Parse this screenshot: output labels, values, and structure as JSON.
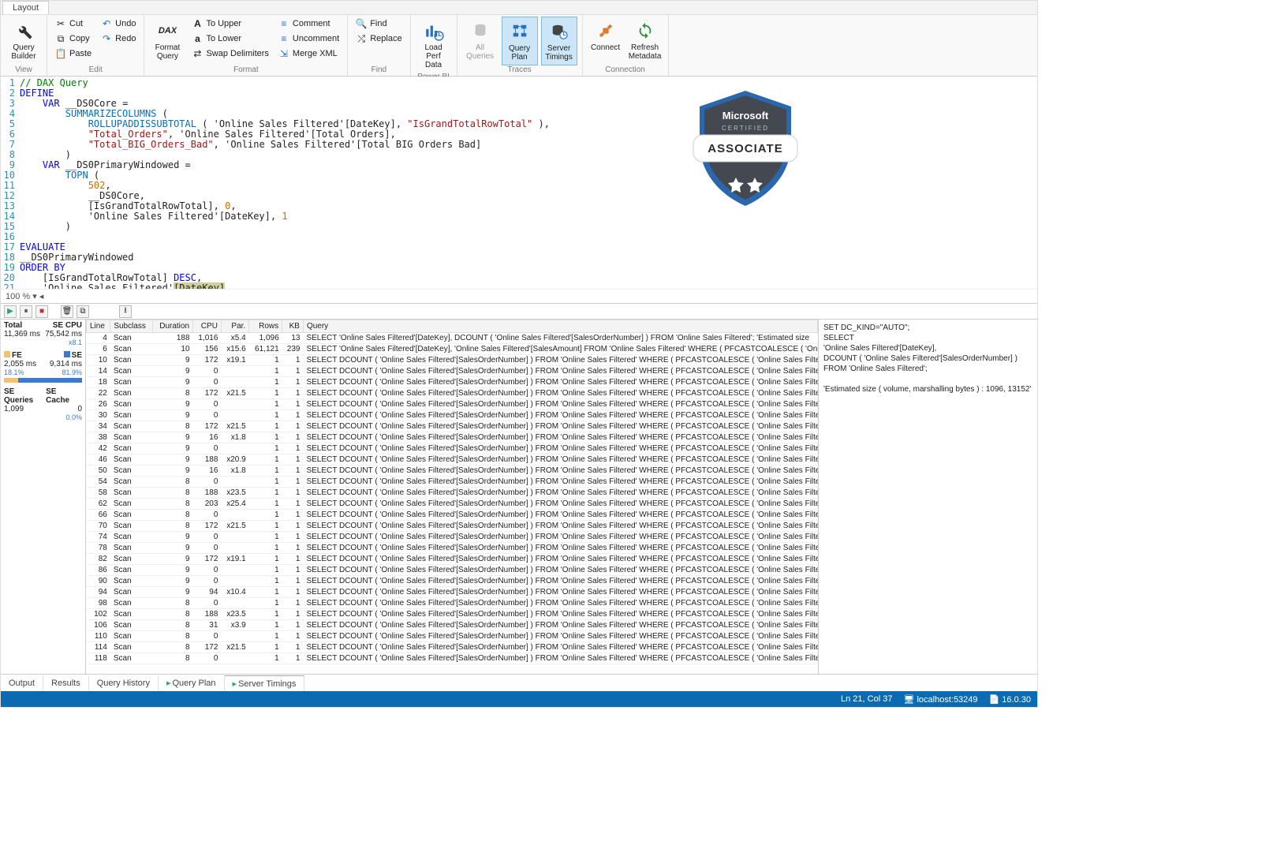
{
  "tabs": {
    "layout": "Layout"
  },
  "ribbon": {
    "view": {
      "label": "View",
      "query_builder": "Query\nBuilder"
    },
    "edit": {
      "label": "Edit",
      "cut": "Cut",
      "copy": "Copy",
      "paste": "Paste",
      "undo": "Undo",
      "redo": "Redo"
    },
    "format": {
      "label": "Format",
      "format_query": "Format\nQuery",
      "to_upper": "To Upper",
      "to_lower": "To Lower",
      "swap": "Swap Delimiters",
      "comment": "Comment",
      "uncomment": "Uncomment",
      "merge_xml": "Merge XML"
    },
    "find": {
      "label": "Find",
      "find": "Find",
      "replace": "Replace"
    },
    "powerbi": {
      "label": "Power BI",
      "load_perf": "Load Perf\nData"
    },
    "traces": {
      "label": "Traces",
      "all_queries": "All\nQueries",
      "query_plan": "Query\nPlan",
      "server_timings": "Server\nTimings"
    },
    "connection": {
      "label": "Connection",
      "connect": "Connect",
      "refresh": "Refresh\nMetadata"
    }
  },
  "zoom": "100 % ▾  ◂",
  "code": {
    "lines": [
      {
        "n": 1,
        "seg": [
          [
            "// DAX Query",
            "tok-comment"
          ]
        ]
      },
      {
        "n": 2,
        "seg": [
          [
            "DEFINE",
            "tok-kw"
          ]
        ]
      },
      {
        "n": 3,
        "seg": [
          [
            "    ",
            ""
          ],
          [
            "VAR",
            "tok-kw"
          ],
          [
            " __DS0Core =",
            ""
          ]
        ]
      },
      {
        "n": 4,
        "seg": [
          [
            "        ",
            ""
          ],
          [
            "SUMMARIZECOLUMNS",
            "tok-func"
          ],
          [
            " (",
            ""
          ]
        ]
      },
      {
        "n": 5,
        "seg": [
          [
            "            ",
            ""
          ],
          [
            "ROLLUPADDISSUBTOTAL",
            "tok-func"
          ],
          [
            " ( 'Online Sales Filtered'[DateKey], ",
            ""
          ],
          [
            "\"IsGrandTotalRowTotal\"",
            "tok-str"
          ],
          [
            " ),",
            ""
          ]
        ]
      },
      {
        "n": 6,
        "seg": [
          [
            "            ",
            ""
          ],
          [
            "\"Total_Orders\"",
            "tok-str"
          ],
          [
            ", 'Online Sales Filtered'[Total Orders],",
            ""
          ]
        ]
      },
      {
        "n": 7,
        "seg": [
          [
            "            ",
            ""
          ],
          [
            "\"Total_BIG_Orders_Bad\"",
            "tok-str"
          ],
          [
            ", 'Online Sales Filtered'[Total BIG Orders Bad]",
            ""
          ]
        ]
      },
      {
        "n": 8,
        "seg": [
          [
            "        )",
            ""
          ]
        ]
      },
      {
        "n": 9,
        "seg": [
          [
            "    ",
            ""
          ],
          [
            "VAR",
            "tok-kw"
          ],
          [
            " __DS0PrimaryWindowed =",
            ""
          ]
        ]
      },
      {
        "n": 10,
        "seg": [
          [
            "        ",
            ""
          ],
          [
            "TOPN",
            "tok-func"
          ],
          [
            " (",
            ""
          ]
        ]
      },
      {
        "n": 11,
        "seg": [
          [
            "            ",
            ""
          ],
          [
            "502",
            "tok-num"
          ],
          [
            ",",
            ""
          ]
        ]
      },
      {
        "n": 12,
        "seg": [
          [
            "            __DS0Core,",
            ""
          ]
        ]
      },
      {
        "n": 13,
        "seg": [
          [
            "            [IsGrandTotalRowTotal], ",
            ""
          ],
          [
            "0",
            "tok-num"
          ],
          [
            ",",
            ""
          ]
        ]
      },
      {
        "n": 14,
        "seg": [
          [
            "            'Online Sales Filtered'[DateKey], ",
            ""
          ],
          [
            "1",
            "tok-num"
          ]
        ]
      },
      {
        "n": 15,
        "seg": [
          [
            "        )",
            ""
          ]
        ]
      },
      {
        "n": 16,
        "seg": [
          [
            "",
            ""
          ]
        ]
      },
      {
        "n": 17,
        "seg": [
          [
            "EVALUATE",
            "tok-kw"
          ]
        ]
      },
      {
        "n": 18,
        "seg": [
          [
            "__DS0PrimaryWindowed",
            ""
          ]
        ]
      },
      {
        "n": 19,
        "seg": [
          [
            "ORDER BY",
            "tok-kw"
          ]
        ]
      },
      {
        "n": 20,
        "seg": [
          [
            "    [IsGrandTotalRowTotal] ",
            ""
          ],
          [
            "DESC",
            "tok-kw"
          ],
          [
            ",",
            ""
          ]
        ]
      },
      {
        "n": 21,
        "seg": [
          [
            "    'Online Sales Filtered'",
            ""
          ],
          [
            "[DateKey]",
            "tok-hl"
          ]
        ]
      }
    ]
  },
  "stats": {
    "headers": [
      "Total",
      "SE CPU"
    ],
    "total": "11,369 ms",
    "se_cpu": "75,542 ms",
    "se_ratio": "x8.1",
    "fe_label": "FE",
    "se_label": "SE",
    "fe_ms": "2,055 ms",
    "se_ms": "9,314 ms",
    "fe_pct": "18.1%",
    "se_pct": "81.9%",
    "seq_label": "SE Queries",
    "sec_label": "SE Cache",
    "seq": "1,099",
    "sec": "0",
    "sec_pct": "0.0%"
  },
  "grid": {
    "cols": [
      "Line",
      "Subclass",
      "Duration",
      "CPU",
      "Par.",
      "Rows",
      "KB",
      "Query"
    ],
    "q1": "SELECT 'Online Sales Filtered'[DateKey], DCOUNT ( 'Online Sales Filtered'[SalesOrderNumber] ) FROM 'Online Sales Filtered';   'Estimated size",
    "q2": "SELECT 'Online Sales Filtered'[DateKey], 'Online Sales Filtered'[SalesAmount] FROM 'Online Sales Filtered' WHERE ( PFCASTCOALESCE ( 'Onlin",
    "qd": "SELECT DCOUNT ( 'Online Sales Filtered'[SalesOrderNumber] ) FROM 'Online Sales Filtered' WHERE ( PFCASTCOALESCE ( 'Online Sales Filtere",
    "rows": [
      {
        "l": 4,
        "sc": "Scan",
        "d": 188,
        "c": "1,016",
        "p": "x5.4",
        "r": "1,096",
        "k": 13,
        "qref": "q1"
      },
      {
        "l": 6,
        "sc": "Scan",
        "d": 10,
        "c": 156,
        "p": "x15.6",
        "r": "61,121",
        "k": 239,
        "qref": "q2"
      },
      {
        "l": 10,
        "sc": "Scan",
        "d": 9,
        "c": 172,
        "p": "x19.1",
        "r": 1,
        "k": 1,
        "qref": "qd"
      },
      {
        "l": 14,
        "sc": "Scan",
        "d": 9,
        "c": 0,
        "p": "",
        "r": 1,
        "k": 1,
        "qref": "qd"
      },
      {
        "l": 18,
        "sc": "Scan",
        "d": 9,
        "c": 0,
        "p": "",
        "r": 1,
        "k": 1,
        "qref": "qd"
      },
      {
        "l": 22,
        "sc": "Scan",
        "d": 8,
        "c": 172,
        "p": "x21.5",
        "r": 1,
        "k": 1,
        "qref": "qd"
      },
      {
        "l": 26,
        "sc": "Scan",
        "d": 9,
        "c": 0,
        "p": "",
        "r": 1,
        "k": 1,
        "qref": "qd"
      },
      {
        "l": 30,
        "sc": "Scan",
        "d": 9,
        "c": 0,
        "p": "",
        "r": 1,
        "k": 1,
        "qref": "qd"
      },
      {
        "l": 34,
        "sc": "Scan",
        "d": 8,
        "c": 172,
        "p": "x21.5",
        "r": 1,
        "k": 1,
        "qref": "qd"
      },
      {
        "l": 38,
        "sc": "Scan",
        "d": 9,
        "c": 16,
        "p": "x1.8",
        "r": 1,
        "k": 1,
        "qref": "qd"
      },
      {
        "l": 42,
        "sc": "Scan",
        "d": 9,
        "c": 0,
        "p": "",
        "r": 1,
        "k": 1,
        "qref": "qd"
      },
      {
        "l": 46,
        "sc": "Scan",
        "d": 9,
        "c": 188,
        "p": "x20.9",
        "r": 1,
        "k": 1,
        "qref": "qd"
      },
      {
        "l": 50,
        "sc": "Scan",
        "d": 9,
        "c": 16,
        "p": "x1.8",
        "r": 1,
        "k": 1,
        "qref": "qd"
      },
      {
        "l": 54,
        "sc": "Scan",
        "d": 8,
        "c": 0,
        "p": "",
        "r": 1,
        "k": 1,
        "qref": "qd"
      },
      {
        "l": 58,
        "sc": "Scan",
        "d": 8,
        "c": 188,
        "p": "x23.5",
        "r": 1,
        "k": 1,
        "qref": "qd"
      },
      {
        "l": 62,
        "sc": "Scan",
        "d": 8,
        "c": 203,
        "p": "x25.4",
        "r": 1,
        "k": 1,
        "qref": "qd"
      },
      {
        "l": 66,
        "sc": "Scan",
        "d": 8,
        "c": 0,
        "p": "",
        "r": 1,
        "k": 1,
        "qref": "qd"
      },
      {
        "l": 70,
        "sc": "Scan",
        "d": 8,
        "c": 172,
        "p": "x21.5",
        "r": 1,
        "k": 1,
        "qref": "qd"
      },
      {
        "l": 74,
        "sc": "Scan",
        "d": 9,
        "c": 0,
        "p": "",
        "r": 1,
        "k": 1,
        "qref": "qd"
      },
      {
        "l": 78,
        "sc": "Scan",
        "d": 9,
        "c": 0,
        "p": "",
        "r": 1,
        "k": 1,
        "qref": "qd"
      },
      {
        "l": 82,
        "sc": "Scan",
        "d": 9,
        "c": 172,
        "p": "x19.1",
        "r": 1,
        "k": 1,
        "qref": "qd"
      },
      {
        "l": 86,
        "sc": "Scan",
        "d": 9,
        "c": 0,
        "p": "",
        "r": 1,
        "k": 1,
        "qref": "qd"
      },
      {
        "l": 90,
        "sc": "Scan",
        "d": 9,
        "c": 0,
        "p": "",
        "r": 1,
        "k": 1,
        "qref": "qd"
      },
      {
        "l": 94,
        "sc": "Scan",
        "d": 9,
        "c": 94,
        "p": "x10.4",
        "r": 1,
        "k": 1,
        "qref": "qd"
      },
      {
        "l": 98,
        "sc": "Scan",
        "d": 8,
        "c": 0,
        "p": "",
        "r": 1,
        "k": 1,
        "qref": "qd"
      },
      {
        "l": 102,
        "sc": "Scan",
        "d": 8,
        "c": 188,
        "p": "x23.5",
        "r": 1,
        "k": 1,
        "qref": "qd"
      },
      {
        "l": 106,
        "sc": "Scan",
        "d": 8,
        "c": 31,
        "p": "x3.9",
        "r": 1,
        "k": 1,
        "qref": "qd"
      },
      {
        "l": 110,
        "sc": "Scan",
        "d": 8,
        "c": 0,
        "p": "",
        "r": 1,
        "k": 1,
        "qref": "qd"
      },
      {
        "l": 114,
        "sc": "Scan",
        "d": 8,
        "c": 172,
        "p": "x21.5",
        "r": 1,
        "k": 1,
        "qref": "qd"
      },
      {
        "l": 118,
        "sc": "Scan",
        "d": 8,
        "c": 0,
        "p": "",
        "r": 1,
        "k": 1,
        "qref": "qd"
      }
    ]
  },
  "detail": [
    "SET DC_KIND=\"AUTO\";",
    "SELECT",
    "'Online Sales Filtered'[DateKey],",
    "DCOUNT ( 'Online Sales Filtered'[SalesOrderNumber] )",
    "FROM 'Online Sales Filtered';",
    "",
    "'Estimated size ( volume, marshalling bytes ) : 1096, 13152'"
  ],
  "bottom_tabs": {
    "output": "Output",
    "results": "Results",
    "history": "Query History",
    "plan": "Query Plan",
    "timings": "Server Timings"
  },
  "status": {
    "pos": "Ln 21, Col 37",
    "conn": "localhost:53249",
    "ver": "16.0.30"
  },
  "badge": {
    "top": "Microsoft",
    "mid": "CERTIFIED",
    "assoc": "ASSOCIATE"
  }
}
